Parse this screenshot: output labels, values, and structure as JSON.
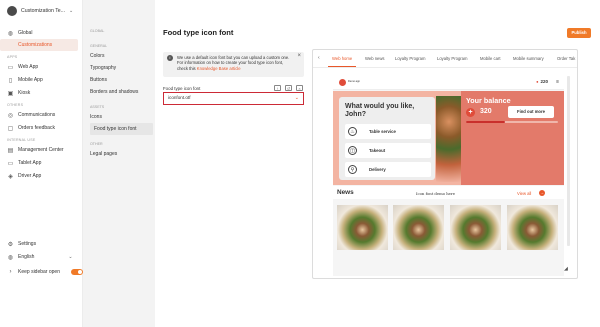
{
  "brand": {
    "name": "Customization Te...",
    "chevron": "⌄"
  },
  "sidebar": {
    "items": [
      {
        "label": "Global",
        "icon": "globe-icon",
        "glyph": "◍"
      },
      {
        "label": "Customizations",
        "active": true
      },
      {
        "group": "APPS"
      },
      {
        "label": "Web App",
        "icon": "monitor-icon",
        "glyph": "▭"
      },
      {
        "label": "Mobile App",
        "icon": "phone-icon",
        "glyph": "▯"
      },
      {
        "label": "Kiosk",
        "icon": "kiosk-icon",
        "glyph": "▣"
      },
      {
        "group": "OTHERS"
      },
      {
        "label": "Communications",
        "icon": "megaphone-icon",
        "glyph": "◎"
      },
      {
        "label": "Orders feedback",
        "icon": "feedback-icon",
        "glyph": "▢"
      },
      {
        "group": "INTERNAL USE"
      },
      {
        "label": "Management Center",
        "icon": "management-icon",
        "glyph": "▤"
      },
      {
        "label": "Tablet App",
        "icon": "tablet-icon",
        "glyph": "▭"
      },
      {
        "label": "Driver App",
        "icon": "driver-icon",
        "glyph": "◈"
      }
    ],
    "settings": "Settings",
    "language": "English",
    "keep_open": "Keep sidebar open",
    "accent": "#e8572a"
  },
  "submenu": {
    "global_group": "GLOBAL",
    "general_group": "GENERAL",
    "colors": "Colors",
    "typography": "Typography",
    "buttons": "Buttons",
    "borders": "Borders and shadows",
    "assets_group": "ASSETS",
    "icons": "Icons",
    "food_icon_font": "Food type icon font",
    "other_group": "OTHER",
    "legal": "Legal pages"
  },
  "main": {
    "title": "Food type icon font",
    "publish": "Publish",
    "info": {
      "text": "We use a default icon font but you can upload a custom one. For information on how to create your food type icon font, check this",
      "link": "Knowledge Base article"
    },
    "field_label": "Food type icon font",
    "select_value": "iconfont.otf"
  },
  "preview": {
    "tabs": [
      "Web home",
      "Web news",
      "Loyalty Program",
      "Loyalty Program",
      "Mobile cart",
      "Mobile summary",
      "Order Tak"
    ],
    "app": {
      "logo_text": "Demo app",
      "points": "220",
      "menu_glyph": "≡",
      "what_title": "What would you like, John?",
      "options": [
        {
          "label": "Table service",
          "icon": "table-service-icon",
          "glyph": "♨"
        },
        {
          "label": "Takeout",
          "icon": "takeout-icon",
          "glyph": "◫"
        },
        {
          "label": "Delivery",
          "icon": "delivery-icon",
          "glyph": "⚲"
        }
      ],
      "balance_title": "Your balance",
      "balance_value": "320",
      "find_more": "Find out more",
      "balance_progress": 0.42,
      "news_title": "News",
      "news_sub": "Icon font demo here",
      "view_all": "View all"
    }
  }
}
